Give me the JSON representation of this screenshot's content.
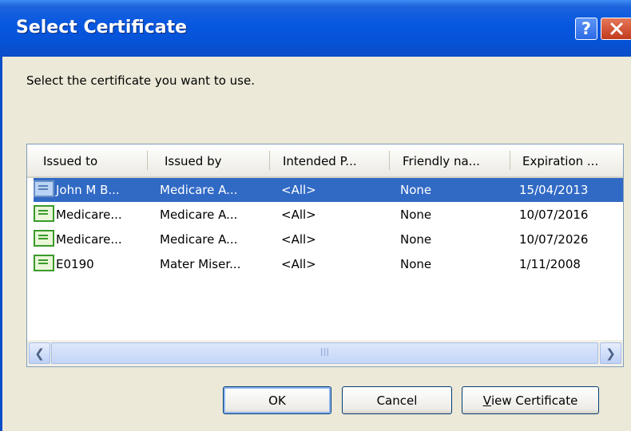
{
  "window": {
    "title": "Select Certificate",
    "help_label": "?",
    "close_label": "✕"
  },
  "instruction": "Select the certificate you want to use.",
  "columns": [
    "Issued to",
    "Issued by",
    "Intended P...",
    "Friendly na...",
    "Expiration ..."
  ],
  "rows": [
    {
      "issued_to": "John M B...",
      "issued_by": "Medicare A...",
      "purpose": "<All>",
      "friendly": "None",
      "expiration": "15/04/2013",
      "selected": true
    },
    {
      "issued_to": "Medicare...",
      "issued_by": "Medicare A...",
      "purpose": "<All>",
      "friendly": "None",
      "expiration": "10/07/2016",
      "selected": false
    },
    {
      "issued_to": "Medicare...",
      "issued_by": "Medicare A...",
      "purpose": "<All>",
      "friendly": "None",
      "expiration": "10/07/2026",
      "selected": false
    },
    {
      "issued_to": "E0190",
      "issued_by": "Mater Miser...",
      "purpose": "<All>",
      "friendly": "None",
      "expiration": "1/11/2008",
      "selected": false
    }
  ],
  "scrollbar": {
    "grip": "III"
  },
  "buttons": {
    "ok": "OK",
    "cancel": "Cancel",
    "view_first": "V",
    "view_rest": "iew Certificate"
  },
  "colors": {
    "titlebar": "#0553d8",
    "selection": "#316ac5",
    "dialog_bg": "#ece9d8"
  }
}
